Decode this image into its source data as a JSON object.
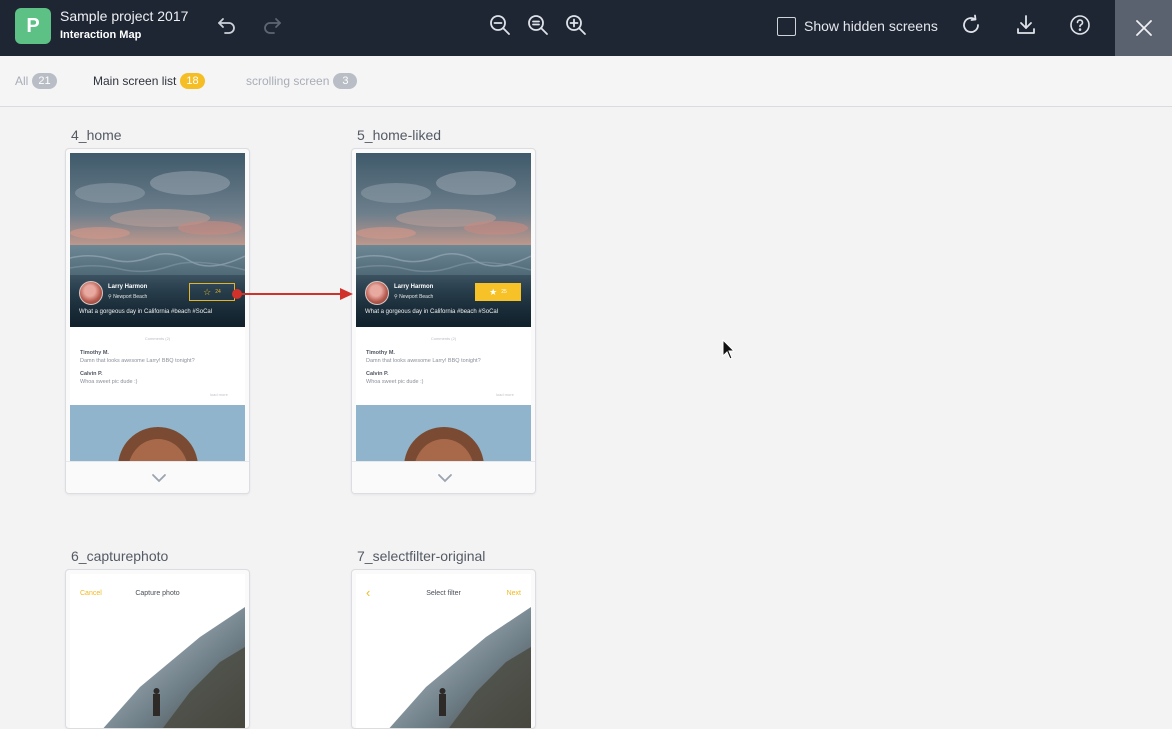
{
  "app": {
    "project_title": "Sample project 2017",
    "view_title": "Interaction Map",
    "logo_letter": "P",
    "brand_color": "#5dc084"
  },
  "toolbar": {
    "undo_icon": "undo-icon",
    "redo_icon": "redo-icon",
    "zoom_out_icon": "zoom-out-icon",
    "zoom_reset_icon": "zoom-reset-icon",
    "zoom_in_icon": "zoom-in-icon",
    "show_hidden_label": "Show hidden screens",
    "show_hidden_checked": false,
    "refresh_icon": "refresh-icon",
    "download_icon": "download-icon",
    "help_icon": "help-icon",
    "close_icon": "close-icon"
  },
  "filters": [
    {
      "label": "All",
      "count": "21",
      "active": false,
      "badge_color": "#b9bdc6"
    },
    {
      "label": "Main screen list",
      "count": "18",
      "active": true,
      "badge_color": "#f5be25"
    },
    {
      "label": "scrolling screen",
      "count": "3",
      "active": false,
      "badge_color": "#b9bdc6"
    }
  ],
  "screens": [
    {
      "name": "4_home",
      "user": "Larry Harmon",
      "location": "Newport Beach",
      "caption": "What a gorgeous day in California #beach #SoCal",
      "likes": "24",
      "comments_label": "Comments (2)",
      "comments": [
        {
          "name": "Timothy M.",
          "text": "Damn that looks awesome Larry! BBQ tonight?"
        },
        {
          "name": "Calvin P.",
          "text": "Whoa sweet pic dude :)"
        }
      ],
      "load_more": "load more"
    },
    {
      "name": "5_home-liked",
      "user": "Larry Harmon",
      "location": "Newport Beach",
      "caption": "What a gorgeous day in California #beach #SoCal",
      "likes": "25",
      "comments_label": "Comments (2)",
      "comments": [
        {
          "name": "Timothy M.",
          "text": "Damn that looks awesome Larry! BBQ tonight?"
        },
        {
          "name": "Calvin P.",
          "text": "Whoa sweet pic dude :)"
        }
      ],
      "load_more": "load more"
    },
    {
      "name": "6_capturephoto",
      "left_action": "Cancel",
      "title": "Capture photo",
      "right_action": ""
    },
    {
      "name": "7_selectfilter-original",
      "left_action": "‹",
      "title": "Select filter",
      "right_action": "Next"
    }
  ],
  "link_color": "#d0322b"
}
